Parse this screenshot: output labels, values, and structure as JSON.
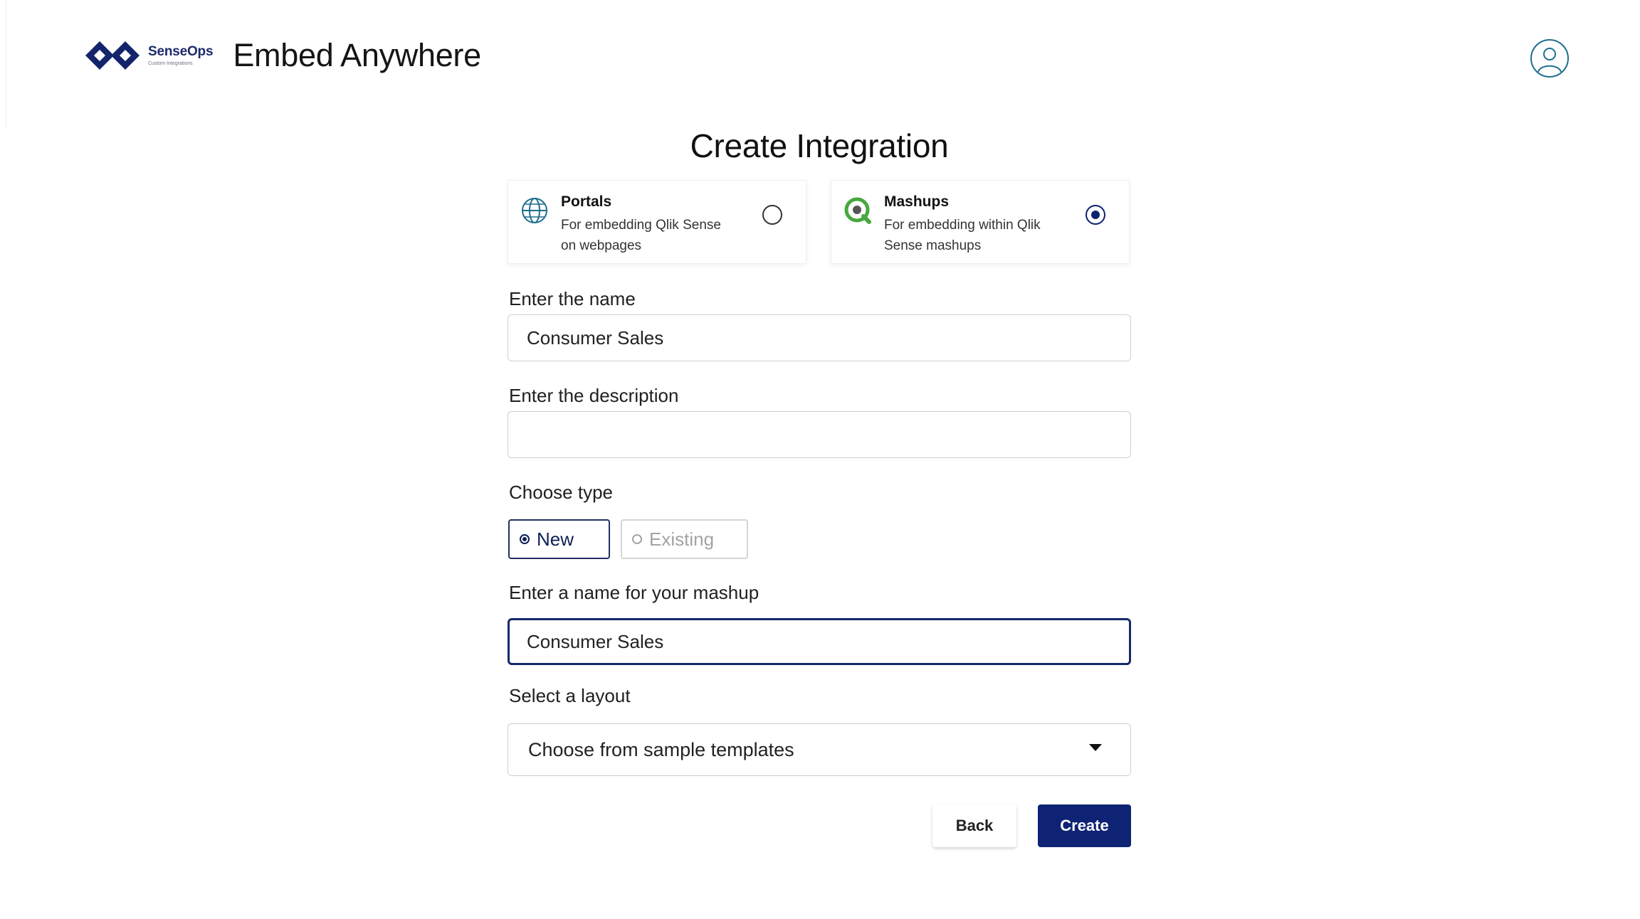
{
  "brand": {
    "logo_name": "SenseOps",
    "logo_sub": "Custom Integrations",
    "app_title": "Embed Anywhere",
    "colors": {
      "primary": "#0e2373",
      "accent": "#1e6f8e",
      "qlik_green": "#46a83e"
    }
  },
  "header": {
    "profile_icon": "user-circle-icon"
  },
  "page": {
    "title": "Create Integration"
  },
  "options": [
    {
      "title": "Portals",
      "description": "For embedding Qlik Sense on webpages",
      "icon": "globe-icon",
      "selected": false
    },
    {
      "title": "Mashups",
      "description": "For embedding within Qlik Sense mashups",
      "icon": "qlik-icon",
      "selected": true
    }
  ],
  "form": {
    "name_label": "Enter the name",
    "name_value": "Consumer Sales",
    "description_label": "Enter the description",
    "description_value": "",
    "type_label": "Choose type",
    "type_options": [
      "New",
      "Existing"
    ],
    "type_selected": "New",
    "mashup_label": "Enter a name for your mashup",
    "mashup_value": "Consumer Sales",
    "layout_label": "Select a layout",
    "layout_value": "Choose from sample templates"
  },
  "buttons": {
    "back": "Back",
    "create": "Create"
  }
}
